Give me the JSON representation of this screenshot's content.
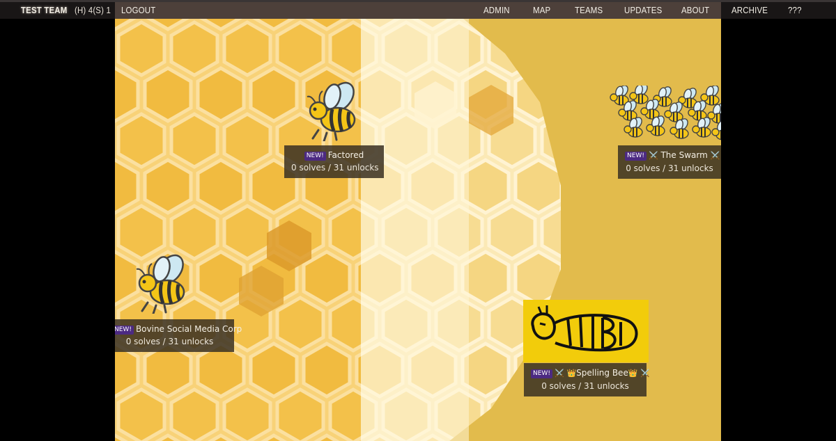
{
  "nav": {
    "team_name": "TEST TEAM",
    "score_h_label": "(H)",
    "score_h_value": "4",
    "score_s_label": "(S)",
    "score_s_value": "1",
    "logout": "LOGOUT",
    "items": [
      "ADMIN",
      "MAP",
      "TEAMS",
      "UPDATES",
      "ABOUT",
      "ARCHIVE",
      "???"
    ]
  },
  "puzzles": [
    {
      "badge": "NEW!",
      "title": "Factored",
      "stats": "0 solves / 31 unlocks",
      "icon": "bee-icon"
    },
    {
      "badge": "NEW!",
      "prefix": "⚔️",
      "title": "The Swarm",
      "suffix": "⚔️",
      "stats": "0 solves / 31 unlocks",
      "icon": "bee-swarm-icon"
    },
    {
      "badge": "NEW!",
      "title": "Bovine Social Media Corp",
      "stats": "0 solves / 31 unlocks",
      "icon": "bee-icon"
    },
    {
      "badge": "NEW!",
      "prefix": "⚔️",
      "title": "Spelling Bee",
      "crown": "👑",
      "suffix": "⚔️",
      "stats": "0 solves / 31 unlocks",
      "icon": "tbd-bee-icon"
    }
  ],
  "colors": {
    "map_background": "#e2bb4c",
    "label_background": "#3a3123",
    "badge": "#4c2a82",
    "tbd_background": "#f2cc0b"
  }
}
